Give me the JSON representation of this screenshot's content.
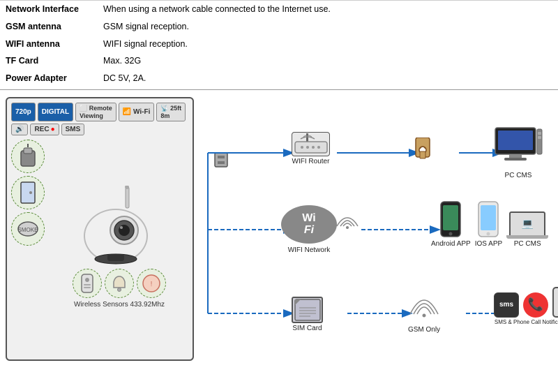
{
  "specs": [
    {
      "label": "Network Interface",
      "value": "When using a network cable connected to the Internet use."
    },
    {
      "label": "GSM antenna",
      "value": "GSM signal reception."
    },
    {
      "label": "WIFI antenna",
      "value": "WIFI signal reception."
    },
    {
      "label": "TF Card",
      "value": "Max. 32G"
    },
    {
      "label": "Power Adapter",
      "value": "DC 5V, 2A."
    }
  ],
  "cam_buttons": [
    {
      "text": "720p",
      "style": "blue"
    },
    {
      "text": "DIGITAL",
      "style": "blue"
    },
    {
      "text": "⬜ Remote Viewing",
      "style": "gray"
    },
    {
      "text": "📶 Wi-Fi",
      "style": "gray"
    },
    {
      "text": "📡 25ft 8m",
      "style": "gray"
    },
    {
      "text": "🔊",
      "style": "gray"
    },
    {
      "text": "REC ●",
      "style": "gray",
      "has_red": true
    },
    {
      "text": "SMS",
      "style": "gray"
    }
  ],
  "cam_label": "Wireless Sensors 433.92Mhz",
  "nodes": {
    "wifi_router_label": "WIFI Router",
    "wifi_network_label": "WIFI Network",
    "sim_card_label": "SIM Card",
    "gsm_only_label": "GSM Only",
    "pc_cms_top_label": "PC CMS",
    "android_app_label": "Android APP",
    "ios_app_label": "IOS APP",
    "pc_cms_bottom_label": "PC CMS",
    "sms_label": "SMS & Phone Call Notification."
  }
}
